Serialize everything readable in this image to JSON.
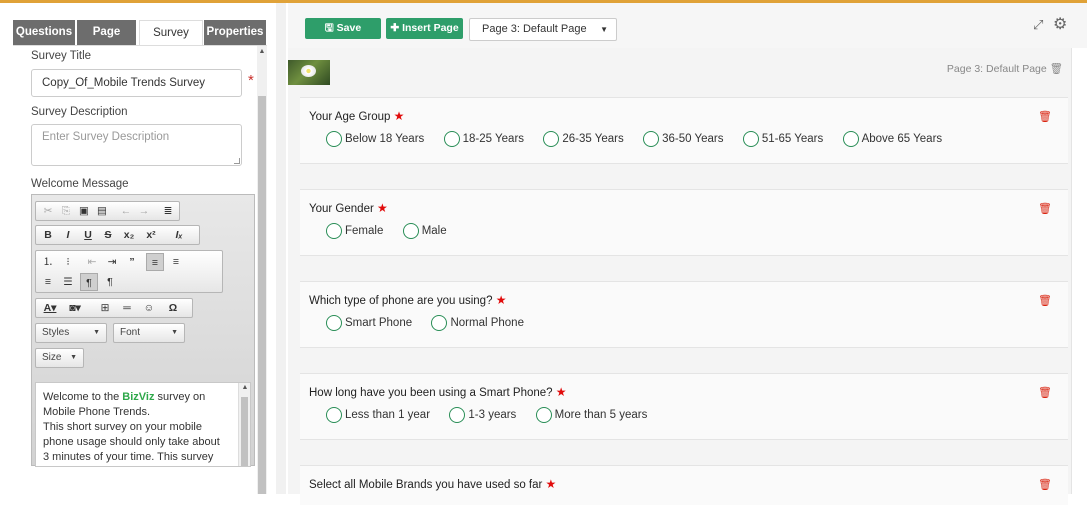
{
  "left_panel": {
    "tabs": [
      {
        "label": "Questions",
        "active": false
      },
      {
        "label": "Page",
        "active": false
      },
      {
        "label": "Survey",
        "active": true
      },
      {
        "label": "Properties",
        "active": false
      }
    ],
    "survey_title": {
      "label": "Survey Title",
      "value": "Copy_Of_Mobile Trends Survey",
      "required_mark": "*"
    },
    "survey_description": {
      "label": "Survey Description",
      "placeholder": "Enter Survey Description"
    },
    "welcome_message": {
      "label": "Welcome Message",
      "combos": {
        "styles": "Styles",
        "font": "Font",
        "size": "Size"
      },
      "content_prefix": "Welcome to the ",
      "content_brand": "BizViz",
      "content_suffix": " survey on Mobile Phone Trends.",
      "content_rest": "This short survey on your mobile phone usage should only take about 3 minutes of your time. This survey will give you 'Real Time Analytics' and 'Benchmark"
    }
  },
  "toolbar": {
    "save_label": "Save",
    "insert_page_label": "Insert Page",
    "page_select_value": "Page 3:  Default Page"
  },
  "canvas": {
    "page_label": "Page 3:  Default Page",
    "questions": [
      {
        "title": "Your Age Group",
        "required": true,
        "options": [
          "Below 18 Years",
          "18-25 Years",
          "26-35 Years",
          "36-50 Years",
          "51-65 Years",
          "Above 65 Years"
        ]
      },
      {
        "title": "Your Gender",
        "required": true,
        "options": [
          "Female",
          "Male"
        ]
      },
      {
        "title": "Which type of phone are you using?",
        "required": true,
        "options": [
          "Smart Phone",
          "Normal Phone"
        ]
      },
      {
        "title": "How long have you been using a Smart Phone?",
        "required": true,
        "options": [
          "Less than 1 year",
          "1-3 years",
          "More than 5 years"
        ]
      },
      {
        "title": "Select all Mobile Brands you have used so far",
        "required": true,
        "options": []
      }
    ]
  },
  "colors": {
    "accent_green": "#2e9e6a",
    "required_red": "#e10b0b",
    "top_rule": "#e0a238",
    "brand_green": "#2ea84a"
  },
  "icons": [
    "save-icon",
    "plus-icon",
    "expand-icon",
    "settings-cogs-icon",
    "trash-icon"
  ]
}
